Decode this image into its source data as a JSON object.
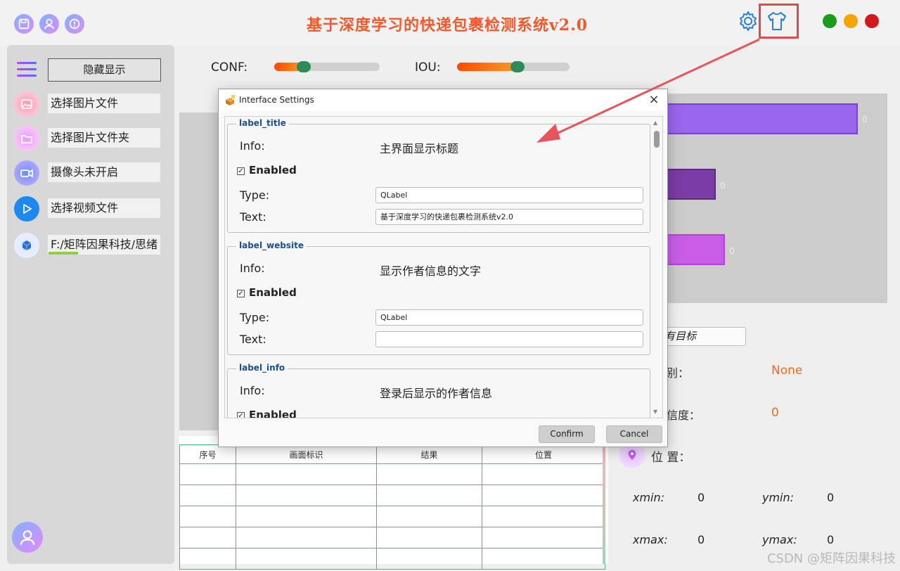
{
  "header": {
    "title": "基于深度学习的快递包裹检测系统v2.0",
    "left_icons": [
      "save-icon",
      "user-icon",
      "info-icon"
    ],
    "right_icons": [
      "gear-icon",
      "tshirt-icon"
    ],
    "window_dots": [
      "#1a9b1a",
      "#f5a500",
      "#d21a1a"
    ]
  },
  "sidebar": {
    "toggle_label": "隐藏显示",
    "items": [
      {
        "label": "选择图片文件",
        "icon": "image-icon"
      },
      {
        "label": "选择图片文件夹",
        "icon": "folder-icon"
      },
      {
        "label": "摄像头未开启",
        "icon": "camera-icon"
      },
      {
        "label": "选择视频文件",
        "icon": "play-icon"
      },
      {
        "label": "F:/矩阵因果科技/思绪",
        "icon": "model-icon"
      }
    ]
  },
  "sliders": {
    "conf_label": "CONF:",
    "conf_value": 0.28,
    "iou_label": "IOU:",
    "iou_value": 0.54
  },
  "chart_data": {
    "type": "bar",
    "orientation": "horizontal",
    "categories": [
      "",
      "",
      ""
    ],
    "values": [
      0,
      0,
      0
    ],
    "data_labels": [
      "0",
      "0",
      "0"
    ],
    "colors": [
      "#9966ee",
      "#7a3da5",
      "#c85ee8"
    ]
  },
  "detection": {
    "target_placeholder": "有目标",
    "class_label": "别：",
    "class_value": "None",
    "confidence_label": "信度：",
    "confidence_value": "0",
    "location_label": "位 置：",
    "xmin_label": "xmin:",
    "xmin_value": "0",
    "ymin_label": "ymin:",
    "ymin_value": "0",
    "xmax_label": "xmax:",
    "xmax_value": "0",
    "ymax_label": "ymax:",
    "ymax_value": "0"
  },
  "table": {
    "headers": [
      "序号",
      "画面标识",
      "结果",
      "位置"
    ]
  },
  "dialog": {
    "title": "Interface Settings",
    "close": "×",
    "groups": [
      {
        "name": "label_title",
        "info_label": "Info:",
        "info": "主界面显示标题",
        "enabled_label": "Enabled",
        "type_label": "Type:",
        "type": "QLabel",
        "text_label": "Text:",
        "text": "基于深度学习的快递包裹检测系统v2.0"
      },
      {
        "name": "label_website",
        "info_label": "Info:",
        "info": "显示作者信息的文字",
        "enabled_label": "Enabled",
        "type_label": "Type:",
        "type": "QLabel",
        "text_label": "Text:",
        "text": ""
      },
      {
        "name": "label_info",
        "info_label": "Info:",
        "info": "登录后显示的作者信息",
        "enabled_label": "Enabled"
      }
    ],
    "confirm": "Confirm",
    "cancel": "Cancel"
  },
  "watermark": "CSDN @矩阵因果科技"
}
